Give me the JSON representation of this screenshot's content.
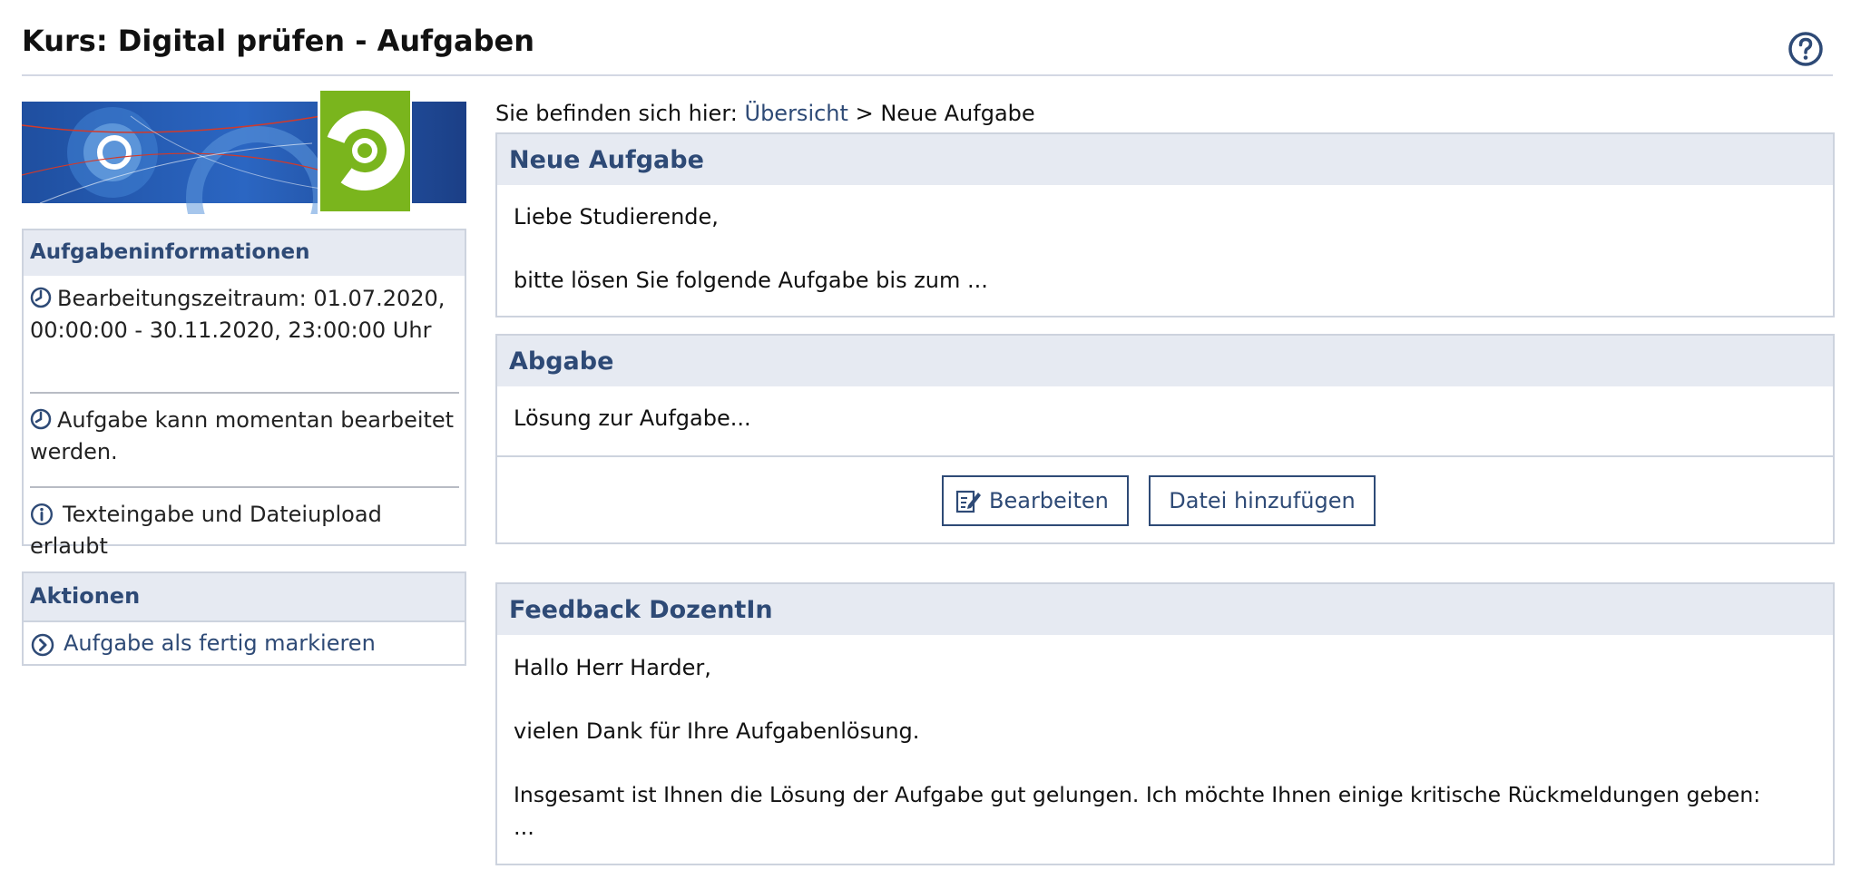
{
  "header": {
    "title": "Kurs: Digital prüfen - Aufgaben",
    "help_icon": "help-circle-icon"
  },
  "colors": {
    "accent": "#2e4a76",
    "panel_header_bg": "#e6eaf2",
    "border": "#cdd3de",
    "logo_green": "#7ab51d"
  },
  "sidebar": {
    "info": {
      "title": "Aufgabeninformationen",
      "items": [
        {
          "icon": "clock-icon",
          "text": "Bearbeitungszeitraum: 01.07.2020, 00:00:00 - 30.11.2020, 23:00:00 Uhr"
        },
        {
          "icon": "clock-icon",
          "text": "Aufgabe kann momentan bearbeitet werden."
        },
        {
          "icon": "info-icon",
          "text": "Texteingabe und Dateiupload erlaubt"
        }
      ]
    },
    "actions": {
      "title": "Aktionen",
      "items": [
        {
          "icon": "chevron-circle-right-icon",
          "label": "Aufgabe als fertig markieren"
        }
      ]
    }
  },
  "breadcrumb": {
    "prefix": "Sie befinden sich hier:",
    "link": "Übersicht",
    "separator": ">",
    "current": "Neue Aufgabe"
  },
  "panels": {
    "neue_aufgabe": {
      "title": "Neue Aufgabe",
      "lines": [
        "Liebe Studierende,",
        "bitte lösen Sie folgende Aufgabe bis zum ..."
      ]
    },
    "abgabe": {
      "title": "Abgabe",
      "text": "Lösung zur Aufgabe...",
      "edit_button": "Bearbeiten",
      "add_file_button": "Datei hinzufügen"
    },
    "feedback": {
      "title": "Feedback DozentIn",
      "lines": [
        "Hallo Herr Harder,",
        "vielen Dank für Ihre Aufgabenlösung.",
        "Insgesamt ist Ihnen die Lösung der Aufgabe gut gelungen. Ich möchte Ihnen einige kritische Rückmeldungen geben:",
        "..."
      ]
    }
  }
}
